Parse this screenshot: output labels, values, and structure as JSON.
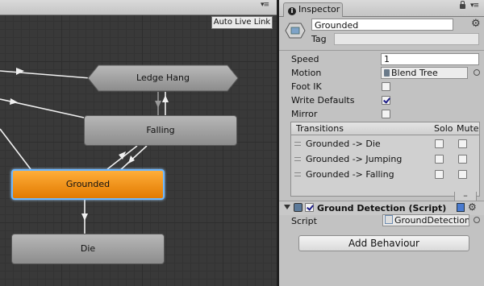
{
  "graph": {
    "auto_live_link": "Auto Live Link",
    "states": {
      "ledge_hang": "Ledge Hang",
      "falling": "Falling",
      "grounded": "Grounded",
      "die": "Die"
    }
  },
  "inspector": {
    "tab_label": "Inspector",
    "name": "Grounded",
    "tag_label": "Tag",
    "properties": {
      "speed_label": "Speed",
      "speed_value": "1",
      "motion_label": "Motion",
      "motion_value": "Blend Tree",
      "foot_ik_label": "Foot IK",
      "foot_ik": false,
      "write_defaults_label": "Write Defaults",
      "write_defaults": true,
      "mirror_label": "Mirror",
      "mirror": false
    },
    "transitions": {
      "header": "Transitions",
      "solo_label": "Solo",
      "mute_label": "Mute",
      "rows": [
        {
          "name": "Grounded -> Die",
          "solo": false,
          "mute": false
        },
        {
          "name": "Grounded -> Jumping",
          "solo": false,
          "mute": false
        },
        {
          "name": "Grounded -> Falling",
          "solo": false,
          "mute": false
        }
      ],
      "remove_label": "–"
    },
    "component": {
      "enabled": true,
      "title": "Ground Detection (Script)",
      "script_label": "Script",
      "script_value": "GroundDetection"
    },
    "add_behaviour_label": "Add Behaviour"
  }
}
